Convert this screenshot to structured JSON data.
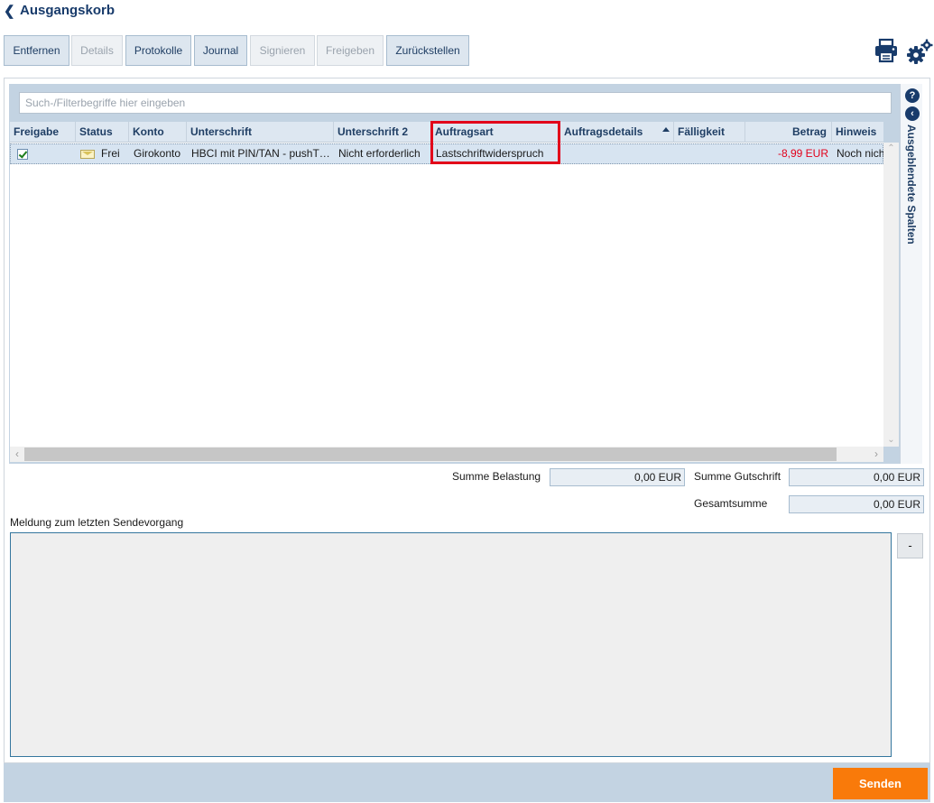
{
  "header": {
    "back_icon": "chevron-left-icon",
    "title": "Ausgangskorb"
  },
  "toolbar": {
    "buttons": [
      {
        "label": "Entfernen",
        "enabled": true
      },
      {
        "label": "Details",
        "enabled": false
      },
      {
        "label": "Protokolle",
        "enabled": true
      },
      {
        "label": "Journal",
        "enabled": true
      },
      {
        "label": "Signieren",
        "enabled": false
      },
      {
        "label": "Freigeben",
        "enabled": false
      },
      {
        "label": "Zurückstellen",
        "enabled": true
      }
    ],
    "print_icon": "printer-icon",
    "settings_icon": "gears-icon"
  },
  "search": {
    "placeholder": "Such-/Filterbegriffe hier eingeben",
    "value": ""
  },
  "table": {
    "columns": [
      "Freigabe",
      "Status",
      "Konto",
      "Unterschrift",
      "Unterschrift 2",
      "Auftragsart",
      "Auftragsdetails",
      "Fälligkeit",
      "Betrag",
      "Hinweis"
    ],
    "sorted_column": "Auftragsdetails",
    "sort_direction": "ascending",
    "rows": [
      {
        "freigabe_checked": true,
        "status_icon": "envelope-icon",
        "status": "Frei",
        "konto": "Girokonto",
        "unterschrift": "HBCI mit PIN/TAN - pushT…",
        "unterschrift2": "Nicht erforderlich",
        "auftragsart": "Lastschriftwiderspruch",
        "auftragsdetails": "",
        "faelligkeit": "",
        "betrag": "-8,99 EUR",
        "hinweis": "Noch nich"
      }
    ],
    "highlight_color": "#e2001a",
    "negative_color": "#e2001a"
  },
  "side_panel": {
    "help_icon": "question-icon",
    "collapse_icon": "chevron-left-circle-icon",
    "label": "Ausgeblendete Spalten"
  },
  "sums": {
    "belastung_label": "Summe Belastung",
    "belastung_value": "0,00 EUR",
    "gutschrift_label": "Summe Gutschrift",
    "gutschrift_value": "0,00 EUR",
    "gesamt_label": "Gesamtsumme",
    "gesamt_value": "0,00 EUR"
  },
  "message": {
    "label": "Meldung zum letzten Sendevorgang",
    "text": "",
    "toggle_label": "-"
  },
  "footer": {
    "send_label": "Senden",
    "send_color": "#f97a0a"
  }
}
